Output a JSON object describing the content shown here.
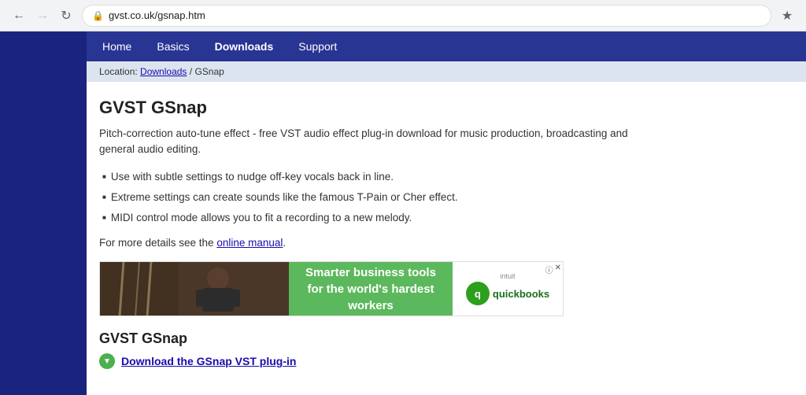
{
  "browser": {
    "url": "gvst.co.uk/gsnap.htm",
    "back_disabled": false,
    "forward_disabled": true
  },
  "nav": {
    "items": [
      {
        "label": "Home",
        "active": false
      },
      {
        "label": "Basics",
        "active": false
      },
      {
        "label": "Downloads",
        "active": true
      },
      {
        "label": "Support",
        "active": false
      }
    ]
  },
  "breadcrumb": {
    "prefix": "Location: ",
    "link_text": "Downloads",
    "separator": " / ",
    "current": "GSnap"
  },
  "content": {
    "title": "GVST GSnap",
    "description": "Pitch-correction auto-tune effect - free VST audio effect plug-in download for music production, broadcasting and general audio editing.",
    "bullets": [
      "Use with subtle settings to nudge off-key vocals back in line.",
      "Extreme settings can create sounds like the famous T-Pain or Cher effect.",
      "MIDI control mode allows you to fit a recording to a new melody."
    ],
    "manual_text": "For more details see the ",
    "manual_link": "online manual",
    "manual_period": ".",
    "ad": {
      "green_text_line1": "Smarter business tools",
      "green_text_line2": "for the world's hardest workers",
      "intuit_label": "intuit",
      "brand_label": "quickbooks"
    },
    "download_section": {
      "title": "GVST GSnap",
      "link_text": "Download the GSnap VST plug-in"
    }
  }
}
